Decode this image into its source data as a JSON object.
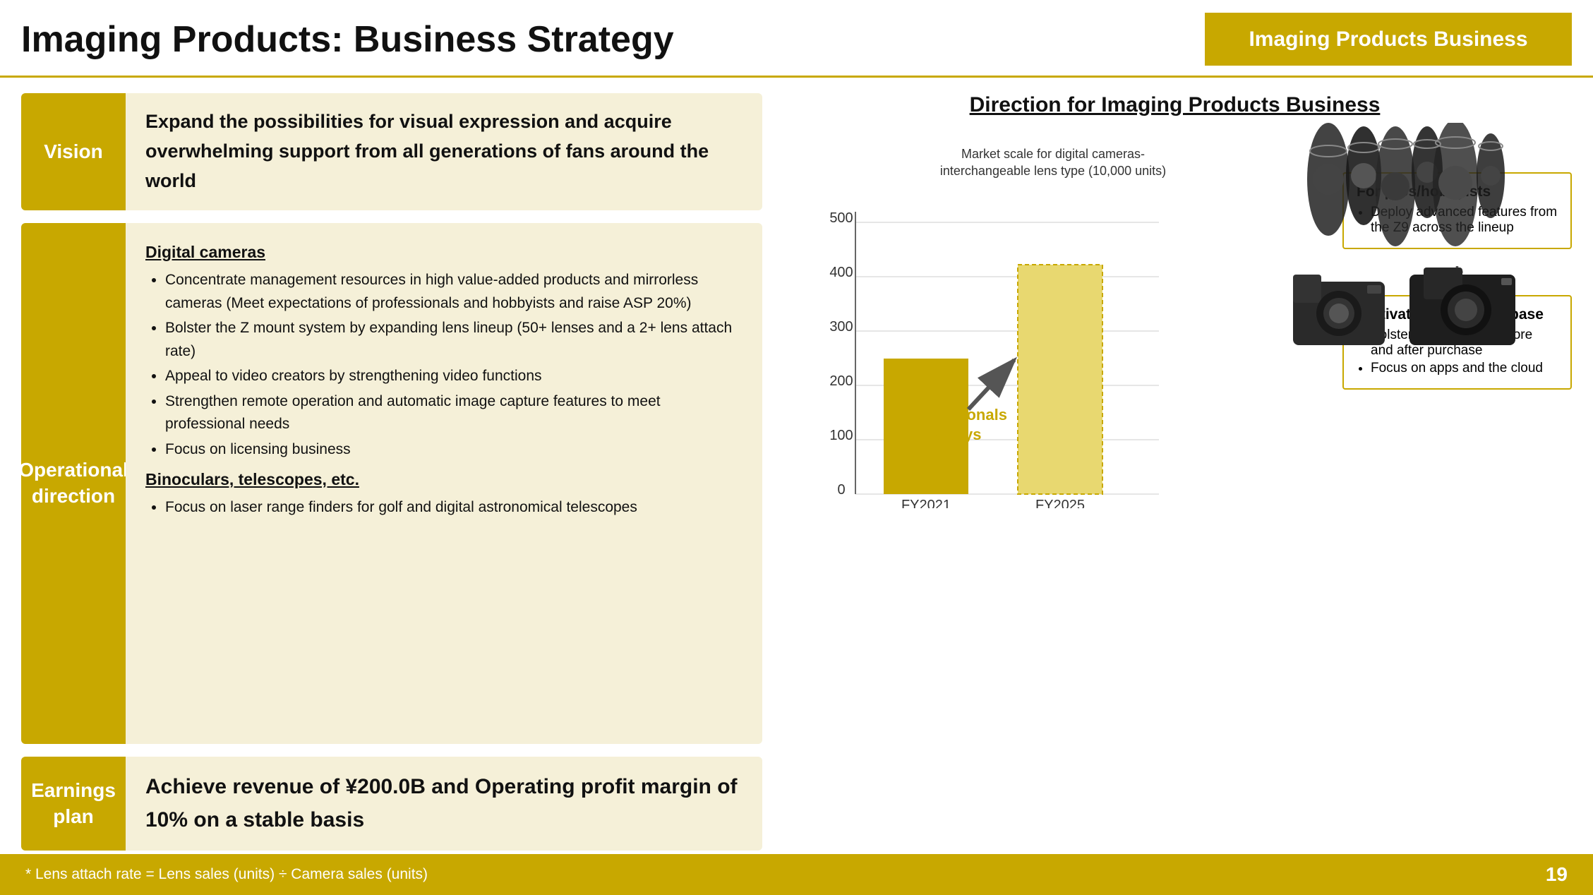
{
  "header": {
    "title": "Imaging Products: Business Strategy",
    "badge": "Imaging Products Business"
  },
  "vision": {
    "label": "Vision",
    "text": "Expand the possibilities for visual expression and acquire overwhelming support from all generations of fans around the world"
  },
  "operational": {
    "label": "Operational\ndirection",
    "digital_cameras_heading": "Digital cameras",
    "bullets": [
      "Concentrate management resources in high value-added products and mirrorless cameras (Meet expectations of professionals and hobbyists and raise ASP 20%)",
      "Bolster the Z mount system by expanding lens lineup (50+ lenses and a 2+ lens attach rate)",
      "Appeal to video creators by strengthening video functions",
      "Strengthen remote operation and automatic image capture features to meet professional needs",
      "Focus on licensing business"
    ],
    "binoculars_heading": "Binoculars, telescopes, etc.",
    "binoculars_bullets": [
      "Focus on laser range finders for golf and digital astronomical telescopes"
    ]
  },
  "earnings": {
    "label": "Earnings\nplan",
    "text": "Achieve revenue of ¥200.0B and Operating profit margin of 10% on a stable basis"
  },
  "direction": {
    "title": "Direction for Imaging Products Business",
    "subtitle": "Market scale for digital cameras-\ninterchangeable lens type (10,000 units)",
    "chart": {
      "y_labels": [
        "0",
        "100",
        "200",
        "300",
        "400",
        "500"
      ],
      "bars": [
        {
          "label": "FY2021",
          "value": 260,
          "max": 520,
          "color": "#c8a800"
        },
        {
          "label": "FY2025",
          "value": 440,
          "max": 520,
          "color": "#e8d880"
        }
      ],
      "prof_label": "Professistionals\nand hobbys"
    },
    "side_boxes": [
      {
        "id": "pros",
        "title": "For pros/hobbyists",
        "bullets": [
          "Deploy advanced features from the Z9 across the lineup"
        ]
      },
      {
        "id": "fans",
        "title": "Cultivate, expand fan base",
        "bullets": [
          "Bolster engagement before and after purchase",
          "Focus on apps and the cloud"
        ]
      }
    ],
    "plus": "+"
  },
  "footer": {
    "note": "* Lens attach rate = Lens sales (units) ÷ Camera sales (units)",
    "page": "19"
  }
}
